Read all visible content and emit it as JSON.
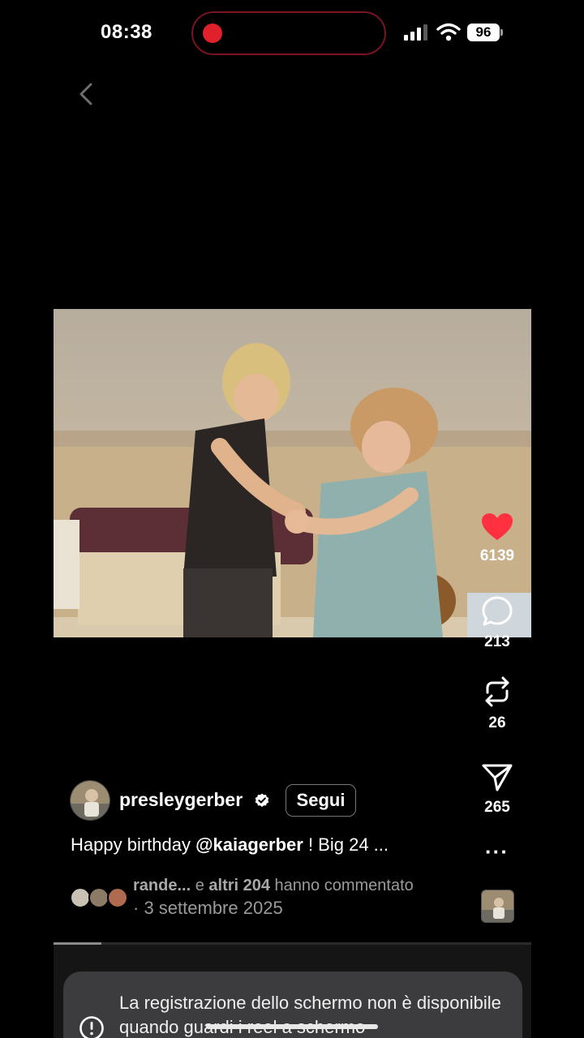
{
  "status_bar": {
    "time": "08:38",
    "battery": "96",
    "recording_color": "#e0202a"
  },
  "nav": {
    "back_icon": "chevron-left-icon"
  },
  "post": {
    "username": "presleygerber",
    "verified": true,
    "follow_label": "Segui",
    "caption_prefix": "Happy birthday ",
    "caption_mention": "@kaiagerber",
    "caption_suffix": " ! Big 24 ...",
    "commenters_lead": "rande...",
    "commenters_and": " e ",
    "commenters_others": "altri 204",
    "commenters_tail": " hanno commentato",
    "date_separator": "·",
    "date": "3 settembre 2025",
    "progress_fraction": 0.1
  },
  "actions": {
    "likes": "6139",
    "comments": "213",
    "reposts": "26",
    "shares": "265",
    "like_color": "#ff3040"
  },
  "toast": {
    "message": "La registrazione dello schermo non è disponibile quando guardi i reel a schermo"
  }
}
